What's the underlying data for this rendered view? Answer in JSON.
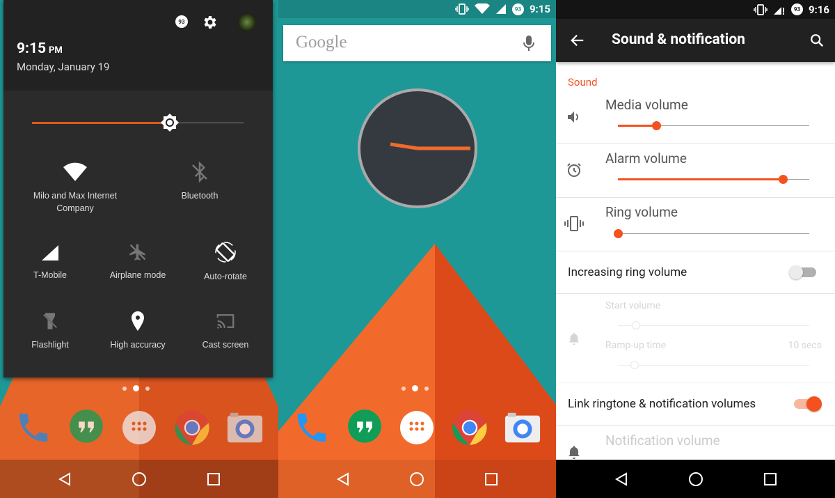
{
  "left_panel": {
    "time": "9:15",
    "ampm": "PM",
    "date": "Monday, January 19",
    "brightness_level": 0.65,
    "tiles": [
      {
        "label": "Milo and Max Internet Company",
        "icon": "wifi-icon",
        "active": true
      },
      {
        "label": "Bluetooth",
        "icon": "bluetooth-off-icon",
        "active": false
      },
      {
        "label": "T-Mobile",
        "icon": "cell-signal-icon",
        "active": true
      },
      {
        "label": "Airplane mode",
        "icon": "airplane-icon",
        "active": false
      },
      {
        "label": "Auto-rotate",
        "icon": "auto-rotate-icon",
        "active": true
      },
      {
        "label": "Flashlight",
        "icon": "flashlight-off-icon",
        "active": false
      },
      {
        "label": "High accuracy",
        "icon": "location-icon",
        "active": true
      },
      {
        "label": "Cast screen",
        "icon": "cast-icon",
        "active": false
      }
    ],
    "badge": "93"
  },
  "middle_panel": {
    "status_time": "9:15",
    "badge": "93",
    "search_logo": "Google"
  },
  "right_panel": {
    "status_time": "9:16",
    "badge": "93",
    "title": "Sound & notification",
    "section": "Sound",
    "sliders": [
      {
        "label": "Media volume",
        "icon": "speaker-icon",
        "value": 0.2
      },
      {
        "label": "Alarm volume",
        "icon": "alarm-icon",
        "value": 0.86
      },
      {
        "label": "Ring volume",
        "icon": "vibrate-icon",
        "value": 0.0
      }
    ],
    "increasing_ring": {
      "label": "Increasing ring volume",
      "on": false
    },
    "start_volume": {
      "label": "Start volume",
      "value": 0.1
    },
    "ramp_up": {
      "label": "Ramp-up time",
      "value_text": "10 secs"
    },
    "link_volumes": {
      "label": "Link ringtone & notification volumes",
      "on": true
    },
    "notification_volume": {
      "label": "Notification volume"
    }
  },
  "colors": {
    "accent": "#f4511e",
    "teal": "#1e9896",
    "shade": "#2b2b2b"
  }
}
